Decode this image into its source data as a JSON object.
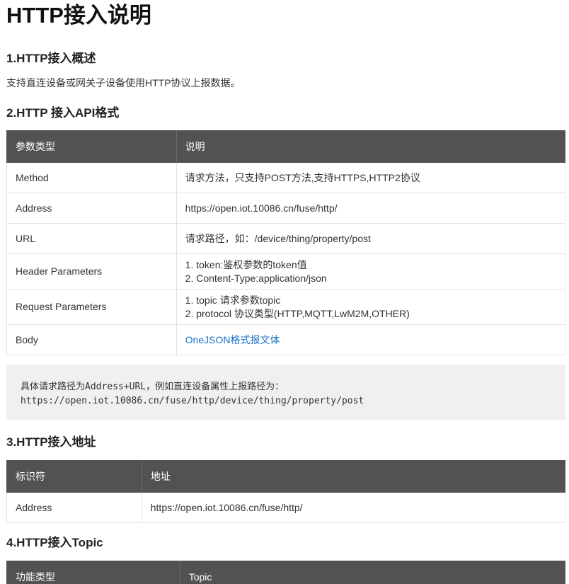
{
  "title": "HTTP接入说明",
  "sections": {
    "s1": {
      "heading": "1.HTTP接入概述",
      "text": "支持直连设备或网关子设备使用HTTP协议上报数据。"
    },
    "s2": {
      "heading": "2.HTTP 接入API格式",
      "headers": [
        "参数类型",
        "说明"
      ],
      "rows": [
        {
          "key": "Method",
          "lines": [
            "请求方法，只支持POST方法,支持HTTPS,HTTP2协议"
          ]
        },
        {
          "key": "Address",
          "lines": [
            "https://open.iot.10086.cn/fuse/http/"
          ]
        },
        {
          "key": "URL",
          "lines": [
            "请求路径，如：/device/thing/property/post"
          ]
        },
        {
          "key": "Header Parameters",
          "lines": [
            "1. token:鉴权参数的token值",
            "2. Content-Type:application/json"
          ]
        },
        {
          "key": "Request Parameters",
          "lines": [
            "1. topic 请求参数topic",
            "2. protocol 协议类型(HTTP,MQTT,LwM2M,OTHER)"
          ]
        },
        {
          "key": "Body",
          "link": "OneJSON格式报文体"
        }
      ],
      "note_line1": "具体请求路径为Address+URL，例如直连设备属性上报路径为：",
      "note_line2": "https://open.iot.10086.cn/fuse/http/device/thing/property/post"
    },
    "s3": {
      "heading": "3.HTTP接入地址",
      "headers": [
        "标识符",
        "地址"
      ],
      "rows": [
        {
          "key": "Address",
          "value": "https://open.iot.10086.cn/fuse/http/"
        }
      ]
    },
    "s4": {
      "heading": "4.HTTP接入Topic",
      "headers": [
        "功能类型",
        "Topic"
      ]
    }
  },
  "colors": {
    "header_bg": "#525252",
    "link": "#1a73c9",
    "note_bg": "#f0f0f0"
  }
}
